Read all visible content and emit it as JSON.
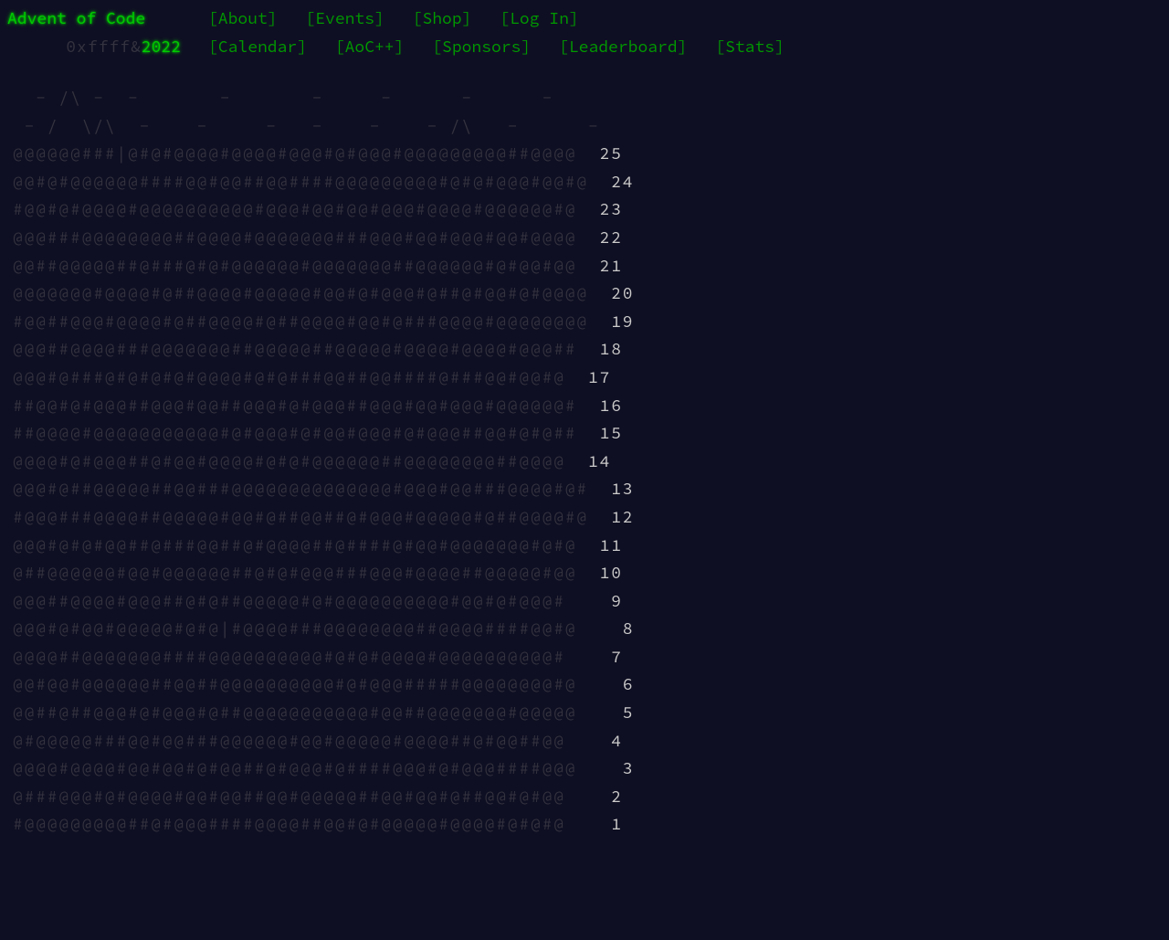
{
  "header": {
    "title": "Advent of Code",
    "prefix": "0xffff&",
    "year": "2022",
    "nav1": [
      {
        "label": "[About]"
      },
      {
        "label": "[Events]"
      },
      {
        "label": "[Shop]"
      },
      {
        "label": "[Log In]"
      }
    ],
    "nav2": [
      {
        "label": "[Calendar]"
      },
      {
        "label": "[AoC++]"
      },
      {
        "label": "[Sponsors]"
      },
      {
        "label": "[Leaderboard]"
      },
      {
        "label": "[Stats]"
      }
    ]
  },
  "calendar": {
    "header_lines": [
      "  - /\\ -  -       -       -     -      -      -    ",
      " - /  \\/\\  -    -     -   -    -    - /\\   -      -"
    ],
    "days": [
      {
        "line": "@@@@@@###|@#@#@@@@#@@@@#@@@#@#@@@#@@@@@@@@@##@@@@  ",
        "num": "25"
      },
      {
        "line": "@@#@#@@@@@@####@@#@@##@@####@@@@@@@@@#@#@#@@@#@@#@  ",
        "num": "24"
      },
      {
        "line": "#@@#@#@@@@#@@@@@@@@@@#@@@#@@#@@#@@@#@@@@#@@@@@@#@  ",
        "num": "23"
      },
      {
        "line": "@@@###@@@@@@@@##@@@@#@@@@@@@###@@@#@@#@@@#@@#@@@@  ",
        "num": "22"
      },
      {
        "line": "@@##@@@@@##@###@#@#@@@@@@#@@@@@@@##@@@@@@#@#@@#@@  ",
        "num": "21"
      },
      {
        "line": "@@@@@@@#@@@@#@##@@@@#@@@@@#@@#@#@@@#@##@#@@#@#@@@@  ",
        "num": "20"
      },
      {
        "line": "#@@##@@@#@@@@#@##@@@@#@##@@@@#@@#@###@@@@#@@@@@@@@  ",
        "num": "19"
      },
      {
        "line": "@@@##@@@@###@@@@@@@##@@@@@##@@@@@#@@@@#@@@@#@@@##  ",
        "num": "18"
      },
      {
        "line": "@@@#@###@#@#@#@#@@@@#@#@###@@##@@####@###@@#@@#@  ",
        "num": "17"
      },
      {
        "line": "##@@#@#@@@##@@@#@@##@@@#@#@@@##@@@#@@#@@@#@@@@@@#  ",
        "num": "16"
      },
      {
        "line": "##@@@@#@@@@@@@@@@@#@#@@@#@#@@#@@@#@#@@@##@@#@#@##  ",
        "num": "15"
      },
      {
        "line": "@@@@#@#@@@##@#@@#@@@@#@#@#@@@@@@##@@@@@@@@##@@@@  ",
        "num": "14"
      },
      {
        "line": "@@@#@##@@@@@##@@###@@@@@@@@@@@@@@#@@@#@@###@@@@#@#  ",
        "num": "13"
      },
      {
        "line": "#@@@###@@@@##@@@@@#@@#@##@@##@#@@@#@@@@@#@##@@@@#@  ",
        "num": "12"
      },
      {
        "line": "@@@#@#@#@@##@###@@##@#@@@@##@####@#@@#@@@@@@@#@#@  ",
        "num": "11"
      },
      {
        "line": "@##@@@@@@#@@#@@@@@@##@#@#@@@###@@@#@@@@##@@@@@#@@  ",
        "num": "10"
      },
      {
        "line": "@@@##@@@@#@@@##@#@##@@@@@#@#@@@@@@@@@@#@@#@#@@@#   ",
        "num": "9"
      },
      {
        "line": "@@@#@#@@#@@@@@#@#@|#@@@@###@@@@@@@@##@@@@####@@#@   ",
        "num": "8"
      },
      {
        "line": "@@@@##@@@@@@@####@@@@@@@@@@#@#@#@@@@#@@@@@@@@@@#   ",
        "num": "7"
      },
      {
        "line": "@@#@@#@@@@@@##@@##@@@@@@@@@@#@#@@@#####@@@@@@@@#@   ",
        "num": "6"
      },
      {
        "line": "@@##@##@@@#@#@@@#@##@@@@@@@@@@@#@@##@@@@@@@#@@@@@   ",
        "num": "5"
      },
      {
        "line": "@#@@@@@###@@#@@###@@@@@@#@@#@@@@@#@@@@##@#@@##@@   ",
        "num": "4"
      },
      {
        "line": "@@@@#@@@@#@@#@@#@#@@##@#@@@#@####@@@#@#@@@####@@@   ",
        "num": "3"
      },
      {
        "line": "@###@@@#@#@@@@#@@#@@##@@#@@@@@##@@#@@#@##@@#@#@@   ",
        "num": "2"
      },
      {
        "line": "#@@@@@@@@@##@#@@@####@@@@##@@#@#@@@@@#@@@@#@#@#@   ",
        "num": "1"
      }
    ]
  }
}
